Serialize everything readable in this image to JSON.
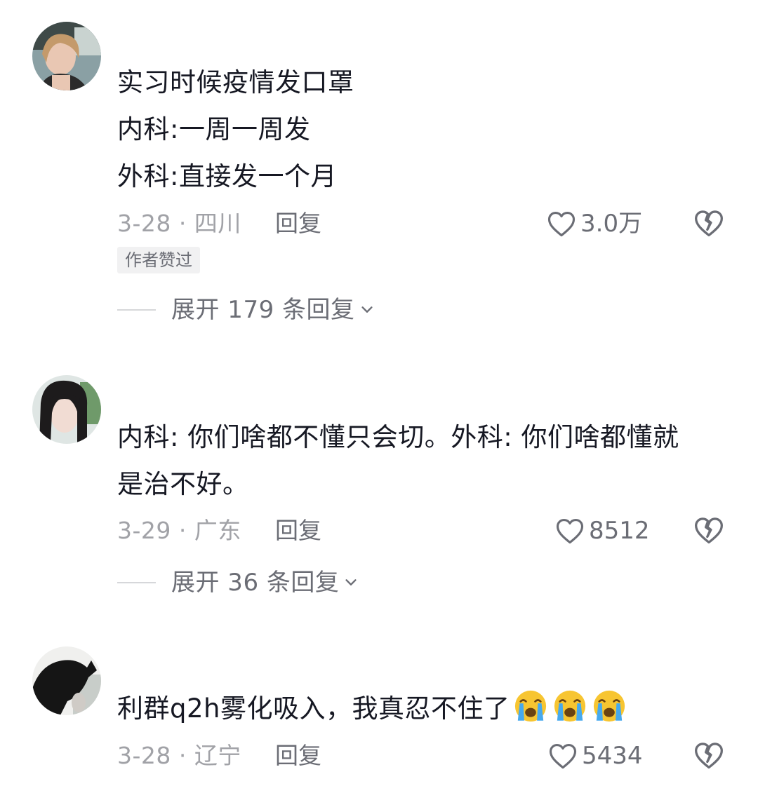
{
  "comments": [
    {
      "lines": [
        "实习时候疫情发口罩",
        "内科:一周一周发",
        "外科:直接发一个月"
      ],
      "date_location": "3-28 · 四川",
      "reply_label": "回复",
      "like_count": "3.0万",
      "author_liked_badge": "作者赞过",
      "expand_label": "展开 179 条回复"
    },
    {
      "lines": [
        "内科: 你们啥都不懂只会切。外科: 你们啥都懂就",
        "是治不好。"
      ],
      "date_location": "3-29 · 广东",
      "reply_label": "回复",
      "like_count": "8512",
      "expand_label": "展开 36 条回复"
    },
    {
      "lines": [
        "利群q2h雾化吸入，我真忍不住了"
      ],
      "emojis": [
        "crying-face",
        "crying-face",
        "crying-face"
      ],
      "date_location": "3-28 · 辽宁",
      "reply_label": "回复",
      "like_count": "5434"
    }
  ],
  "colors": {
    "text_primary": "#161823",
    "text_meta": "#a1a2a7",
    "text_action": "#6b6d75",
    "badge_bg": "#f1f1f2",
    "divider": "#d6d7da"
  },
  "icons": {
    "like": "heart-outline-icon",
    "dislike": "broken-heart-icon",
    "expand": "chevron-down-icon"
  }
}
